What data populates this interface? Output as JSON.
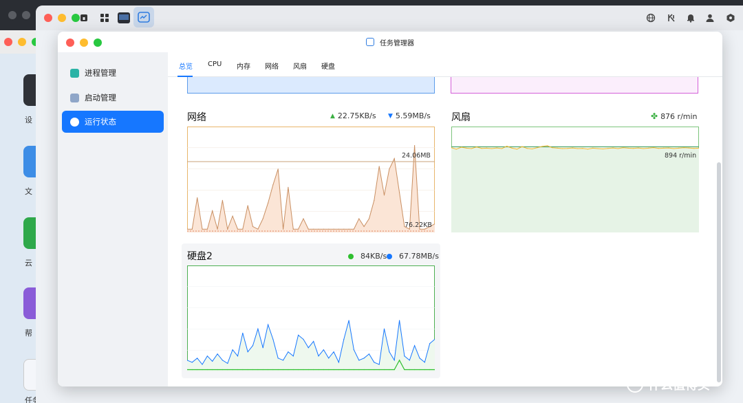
{
  "window": {
    "title": "任务管理器"
  },
  "sidebar": {
    "items": [
      {
        "label": "进程管理",
        "icon": "process-icon"
      },
      {
        "label": "启动管理",
        "icon": "startup-icon"
      },
      {
        "label": "运行状态",
        "icon": "gauge-icon",
        "active": true
      }
    ]
  },
  "tabs": [
    {
      "label": "总览",
      "active": true
    },
    {
      "label": "CPU"
    },
    {
      "label": "内存"
    },
    {
      "label": "网络"
    },
    {
      "label": "风扇"
    },
    {
      "label": "硬盘"
    }
  ],
  "background": {
    "apps": [
      "设",
      "文",
      "云",
      "帮",
      "任务"
    ]
  },
  "network": {
    "title": "网络",
    "upload": "22.75KB/s",
    "download": "5.59MB/s",
    "peak_label": "24.06MB",
    "min_label": "76.22KB",
    "colors": {
      "up": "#3cb043",
      "down": "#1677ff",
      "line": "#c98f62",
      "fill": "#fbe5d6",
      "border": "#e8b56a"
    }
  },
  "fan": {
    "title": "风扇",
    "speed": "876 r/min",
    "ref_label": "894 r/min",
    "colors": {
      "line": "#f0b429",
      "fill": "#e6f3e6",
      "border": "#7cc47c"
    }
  },
  "disk": {
    "title": "硬盘2",
    "read": "84KB/s",
    "write": "67.78MB/s",
    "colors": {
      "read": "#2fbf2f",
      "write": "#1677ff",
      "border": "#4caf50"
    }
  },
  "watermark": "什么值得买",
  "chart_data": [
    {
      "type": "area",
      "title": "网络",
      "x": [
        0,
        1,
        2,
        3,
        4,
        5,
        6,
        7,
        8,
        9,
        10,
        11,
        12,
        13,
        14,
        15,
        16,
        17,
        18,
        19,
        20,
        21,
        22,
        23,
        24,
        25,
        26,
        27,
        28,
        29,
        30,
        31,
        32,
        33,
        34,
        35,
        36,
        37,
        38,
        39,
        40,
        41,
        42,
        43,
        44,
        45,
        46,
        47,
        48,
        49
      ],
      "values": [
        0.5,
        0.5,
        6.5,
        0.5,
        0.5,
        4.0,
        0.5,
        6.0,
        0.5,
        3.0,
        0.5,
        0.5,
        5.0,
        1.0,
        0.5,
        2.5,
        5.5,
        9.0,
        12.0,
        0.5,
        8.5,
        0.5,
        0.5,
        2.5,
        0.5,
        0.5,
        0.5,
        0.5,
        0.5,
        0.5,
        0.5,
        0.5,
        0.5,
        0.5,
        2.5,
        1.0,
        2.5,
        6.0,
        12.5,
        7.0,
        12.0,
        14.0,
        7.5,
        1.0,
        0.5,
        16.5,
        0.5,
        0.5,
        1.0,
        1.5
      ],
      "ylim": [
        0,
        20
      ]
    },
    {
      "type": "line",
      "title": "风扇",
      "x": [
        0,
        1,
        2,
        3,
        4,
        5,
        6,
        7,
        8,
        9,
        10,
        11,
        12,
        13,
        14,
        15,
        16,
        17,
        18,
        19,
        20,
        21,
        22,
        23,
        24,
        25,
        26,
        27,
        28,
        29,
        30,
        31,
        32,
        33,
        34,
        35,
        36,
        37,
        38,
        39,
        40,
        41,
        42,
        43,
        44,
        45,
        46,
        47,
        48,
        49
      ],
      "values": [
        885,
        870,
        890,
        880,
        876,
        892,
        878,
        880,
        876,
        882,
        876,
        900,
        880,
        870,
        896,
        878,
        872,
        885,
        898,
        905,
        884,
        880,
        876,
        878,
        882,
        876,
        878,
        870,
        880,
        876,
        872,
        878,
        882,
        876,
        884,
        880,
        878,
        882,
        876,
        880,
        886,
        878,
        880,
        882,
        876,
        880,
        884,
        882,
        878,
        880
      ],
      "ref": 894,
      "ylim": [
        0,
        1100
      ]
    },
    {
      "type": "line",
      "title": "硬盘2",
      "series": [
        {
          "name": "84KB/s",
          "values": [
            0.1,
            0.1,
            0.1,
            0.1,
            0.1,
            0.1,
            0.1,
            0.1,
            0.1,
            0.1,
            0.1,
            0.1,
            0.1,
            0.1,
            0.1,
            0.1,
            0.1,
            0.1,
            0.1,
            0.1,
            0.1,
            0.1,
            0.1,
            0.1,
            0.1,
            0.1,
            0.1,
            0.1,
            0.1,
            0.1,
            0.1,
            0.1,
            0.1,
            0.1,
            0.1,
            0.1,
            0.1,
            0.1,
            0.1,
            0.1,
            0.1,
            0.1,
            1.0,
            0.1,
            0.1,
            0.1,
            0.1,
            0.1,
            0.1,
            0.1
          ]
        },
        {
          "name": "67.78MB/s",
          "values": [
            10,
            8,
            12,
            6,
            14,
            9,
            16,
            10,
            7,
            20,
            14,
            36,
            18,
            24,
            40,
            22,
            44,
            30,
            12,
            10,
            18,
            14,
            34,
            30,
            22,
            28,
            14,
            20,
            12,
            18,
            8,
            30,
            48,
            20,
            10,
            12,
            16,
            8,
            6,
            40,
            18,
            10,
            48,
            14,
            10,
            24,
            12,
            8,
            26,
            30
          ]
        }
      ],
      "ylim": [
        0,
        100
      ]
    }
  ]
}
